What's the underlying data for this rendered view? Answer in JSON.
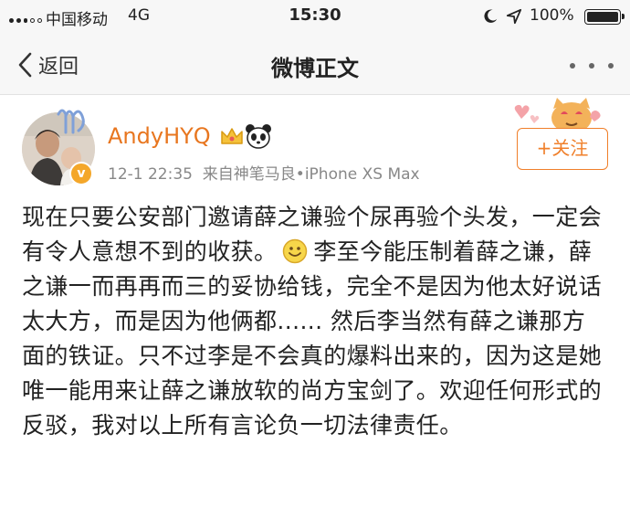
{
  "status_bar": {
    "carrier": "中国移动",
    "network": "4G",
    "time": "15:30",
    "battery": "100%",
    "icons": [
      "signal-icon",
      "moon-icon",
      "location-icon",
      "battery-icon"
    ]
  },
  "nav": {
    "back_label": "返回",
    "title": "微博正文",
    "icons": [
      "chevron-left-icon",
      "more-icon"
    ]
  },
  "post": {
    "username": "AndyHYQ",
    "time": "12-1 22:35",
    "source": "来自神笔马良•iPhone XS Max",
    "follow_label": "+关注",
    "verified_mark": "v",
    "text_part1": "现在只要公安部门邀请薛之谦验个尿再验个头发，一定会有令人意想不到的收获。",
    "text_part2": "李至今能压制着薛之谦，薛之谦一而再再而三的妥协给钱，完全不是因为他太好说话太大方，而是因为他俩都...... 然后李当然有薛之谦那方面的铁证。只不过李是不会真的爆料出来的，因为这是她唯一能用来让薛之谦放软的尚方宝剑了。欢迎任何形式的反驳，我对以上所有言论负一切法律责任。",
    "icons": [
      "avatar",
      "verified-badge-icon",
      "crown-icon",
      "panda-icon",
      "smile-emoji-icon"
    ]
  },
  "colors": {
    "username": "#e8761f",
    "follow": "#f07f2a",
    "meta": "#888888",
    "bar_bg": "#f7f7f7"
  }
}
